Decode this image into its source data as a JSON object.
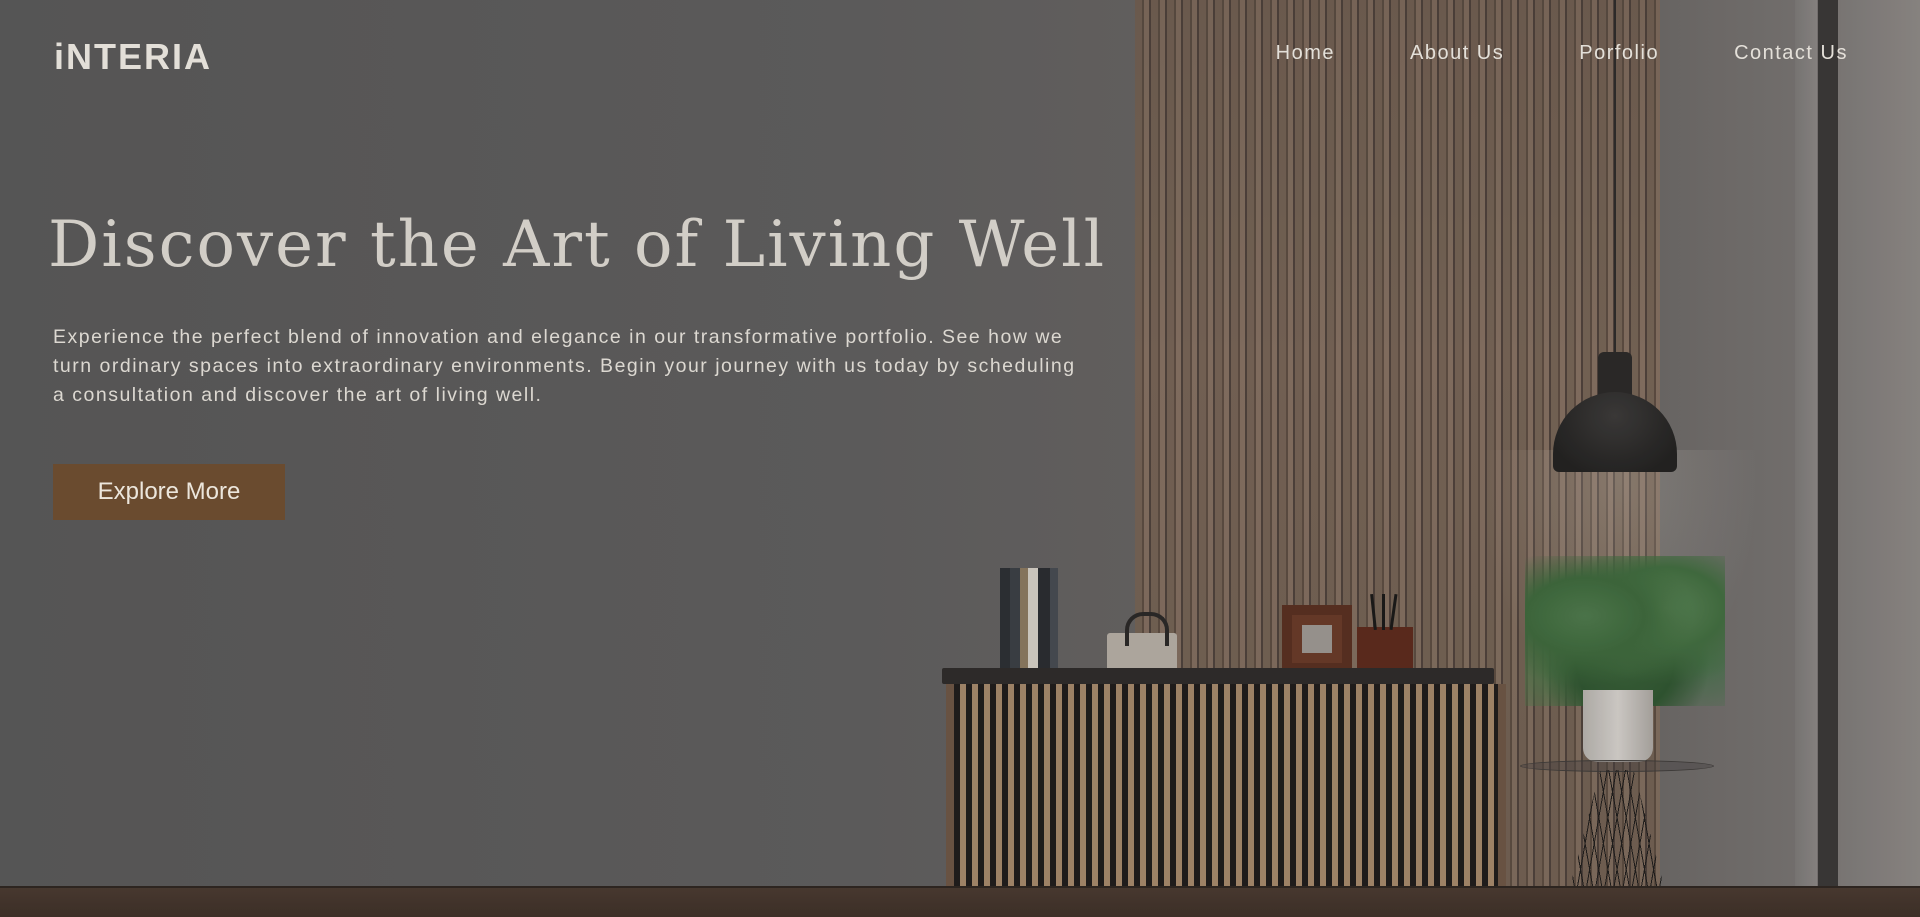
{
  "brand": {
    "logo_text": "iNTERIA"
  },
  "nav": {
    "items": [
      {
        "label": "Home"
      },
      {
        "label": "About Us"
      },
      {
        "label": "Porfolio"
      },
      {
        "label": "Contact Us"
      }
    ]
  },
  "hero": {
    "title": "Discover the Art of Living Well",
    "description": "Experience the perfect blend of innovation and elegance in our transformative portfolio. See how we turn ordinary spaces into extraordinary environments. Begin your journey with us today by scheduling a consultation and discover the art of living well.",
    "cta_label": "Explore More"
  },
  "colors": {
    "accent": "#6a4b2f",
    "text_primary": "#d2cec7",
    "background": "#5b5a5a"
  }
}
